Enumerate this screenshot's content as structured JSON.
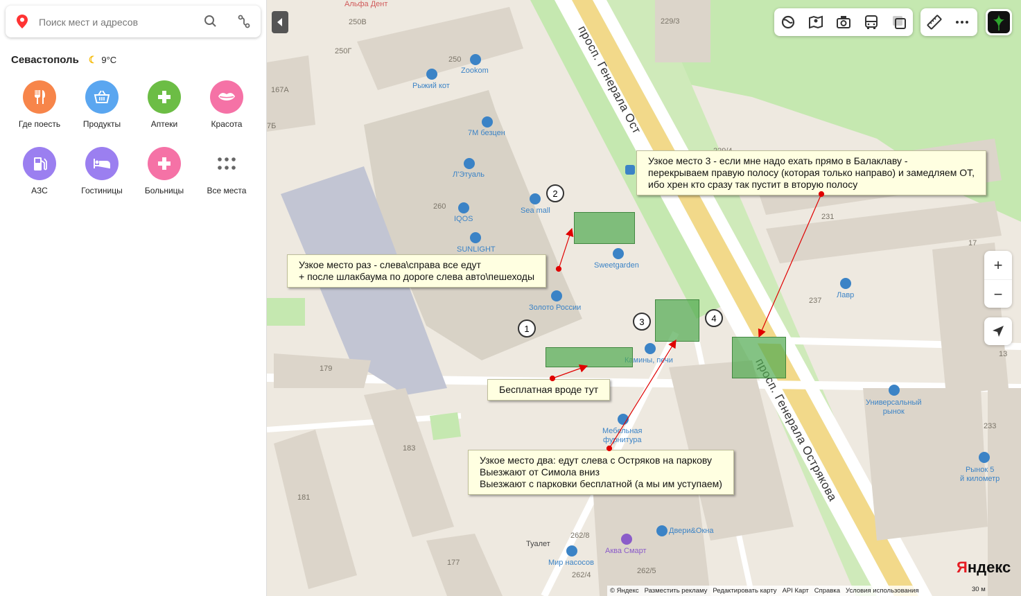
{
  "search": {
    "placeholder": "Поиск мест и адресов"
  },
  "weather": {
    "city": "Севастополь",
    "temp": "9°C"
  },
  "categories": [
    {
      "label": "Где поесть",
      "color": "#f7854a",
      "icon": "food-icon"
    },
    {
      "label": "Продукты",
      "color": "#5aa6f0",
      "icon": "basket-icon"
    },
    {
      "label": "Аптеки",
      "color": "#6cbd45",
      "icon": "pharmacy-icon"
    },
    {
      "label": "Красота",
      "color": "#f572a6",
      "icon": "lips-icon"
    },
    {
      "label": "АЗС",
      "color": "#9b7ff0",
      "icon": "fuel-icon"
    },
    {
      "label": "Гостиницы",
      "color": "#9b7ff0",
      "icon": "bed-icon"
    },
    {
      "label": "Больницы",
      "color": "#f572a6",
      "icon": "hospital-icon"
    },
    {
      "label": "Все места",
      "color": "#ffffff",
      "icon": "grid-icon"
    }
  ],
  "notes": {
    "n1": "Узкое место раз - слева\\справа все едут\n+ после шлакбаума по дороге слева авто\\пешеходы",
    "n2": "Узкое место два: едут слева с Остряков на паркову\nВыезжают от Симола вниз\nВыезжают с парковки бесплатной (а мы им уступаем)",
    "n3": "Узкое место 3 - если мне надо ехать прямо в Балаклаву -\nперекрываем правую полосу (которая только направо) и замедляем ОТ,\nибо хрен кто сразу так пустит в вторую полосу",
    "free": "Бесплатная вроде тут"
  },
  "badges": [
    "1",
    "2",
    "3",
    "4"
  ],
  "streets": {
    "top": "просп. Генерала Ост",
    "bottom": "просп. Генерала Острякова"
  },
  "pois": {
    "alfa": "Альфа Дент",
    "zookom": "Zookom",
    "ryzhiy": "Рыжий кот",
    "sevenm": "7М безцен",
    "letual": "Л'Этуаль",
    "seamall": "Sea mall",
    "iqos": "IQOS",
    "sunlight": "SUNLIGHT",
    "sweetgarden": "Sweetgarden",
    "zoloto": "Золото России",
    "kaminy": "Камины, печи",
    "mebel": "Мебельная\nфурнитура",
    "lavr": "Лавр",
    "univ": "Универсальный\nрынок",
    "rynok5": "Рынок 5\nй километр",
    "dveri": "Двери&Окна",
    "akva": "Аква Смарт",
    "mir": "Мир насосов",
    "tualet": "Туалет"
  },
  "buildings": {
    "b250v": "250В",
    "b250g": "250Г",
    "b250": "250",
    "b167a": "167А",
    "b7b": "7Б",
    "b2293": "229/3",
    "b2294": "229/4",
    "b260": "260",
    "b231": "231",
    "b17": "17",
    "b237": "237",
    "b179": "179",
    "b183": "183",
    "b181": "181",
    "b233": "233",
    "b13": "13",
    "b2628": "262/8",
    "b2624": "262/4",
    "b2625": "262/5",
    "b177": "177"
  },
  "footer": {
    "copyright": "© Яндекс",
    "ads": "Разместить рекламу",
    "edit": "Редактировать карту",
    "api": "API Карт",
    "help": "Справка",
    "terms": "Условия использования",
    "scale": "30 м"
  },
  "logo": {
    "first": "Я",
    "rest": "ндекс"
  }
}
